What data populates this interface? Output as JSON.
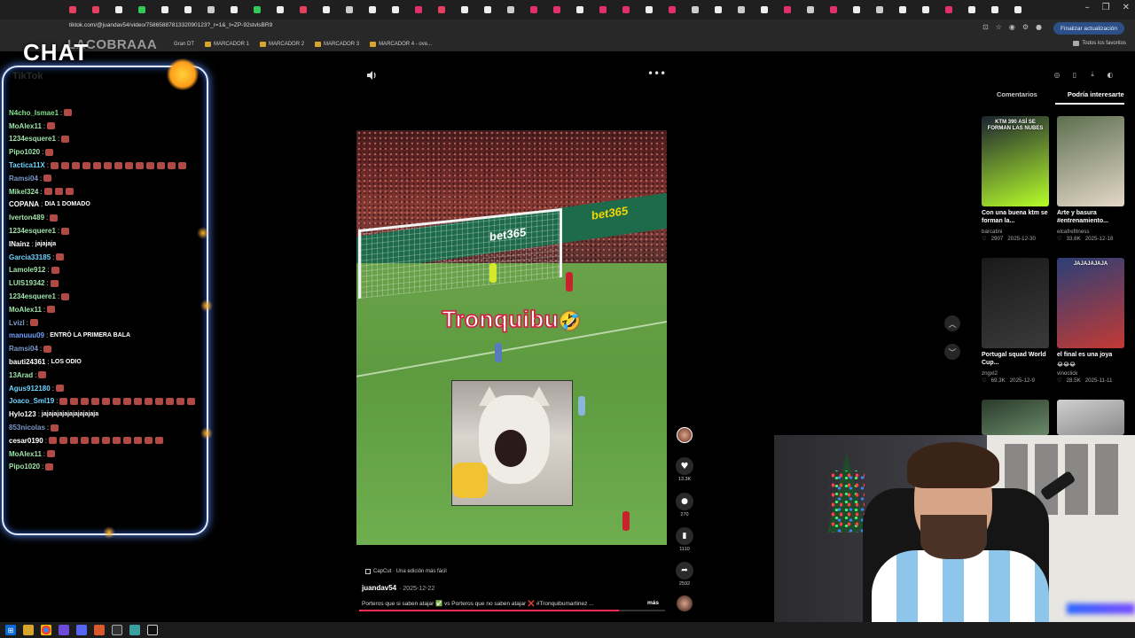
{
  "browser": {
    "url": "tiktok.com/@juandav54/video/7586588781332090123?_r=1&_t=ZP-92stvlsBR9",
    "update_button": "Finalizar actualización",
    "bookmarks": [
      "Gran DT",
      "MARCADOR 1",
      "MARCADOR 2",
      "MARCADOR 3",
      "MARCADOR 4 - ove..."
    ],
    "bookmarks_right": "Todos los favoritos",
    "window_controls": [
      "–",
      "❐",
      "✕"
    ]
  },
  "overlay": {
    "chat_title": "CHAT",
    "brand": "LACOBRAAA",
    "faint_label": "TikTok",
    "accent": "#dfe9ff",
    "glow": "#5a8cff"
  },
  "chat": [
    {
      "user": "N4cho_Ismae1",
      "color": "#7fe38a",
      "text": "",
      "emotes": 1
    },
    {
      "user": "MoAlex11",
      "color": "#9fe3a8",
      "text": "",
      "emotes": 1
    },
    {
      "user": "1234esquere1",
      "color": "#9fe3a8",
      "text": "",
      "emotes": 1
    },
    {
      "user": "Pipo1020",
      "color": "#9fe3a8",
      "text": "",
      "emotes": 1
    },
    {
      "user": "Tactica11X",
      "color": "#6fd4ff",
      "text": "",
      "emotes": 13
    },
    {
      "user": "Ramsi04",
      "color": "#7a9acb",
      "text": "",
      "emotes": 1
    },
    {
      "user": "Mikel324",
      "color": "#9fe3a8",
      "text": "",
      "emotes": 3
    },
    {
      "user": "COPANA",
      "color": "#ffffff",
      "text": "DIA 1 DOMADO",
      "emotes": 0
    },
    {
      "user": "Iverton489",
      "color": "#9fe3a8",
      "text": "",
      "emotes": 1
    },
    {
      "user": "1234esquere1",
      "color": "#9fe3a8",
      "text": "",
      "emotes": 1
    },
    {
      "user": "INainz",
      "color": "#ffffff",
      "text": "jajajaja",
      "emotes": 0
    },
    {
      "user": "Garcia33185",
      "color": "#6fd4ff",
      "text": "",
      "emotes": 1
    },
    {
      "user": "Lamole912",
      "color": "#9fe3a8",
      "text": "",
      "emotes": 1
    },
    {
      "user": "LUIS19342",
      "color": "#9fe3a8",
      "text": "",
      "emotes": 1
    },
    {
      "user": "1234esquere1",
      "color": "#9fe3a8",
      "text": "",
      "emotes": 1
    },
    {
      "user": "MoAlex11",
      "color": "#9fe3a8",
      "text": "",
      "emotes": 1
    },
    {
      "user": "Lvizl",
      "color": "#7a9acb",
      "text": "",
      "emotes": 1
    },
    {
      "user": "manuuu09",
      "color": "#6fa0ff",
      "text": "ENTRÓ LA PRIMERA BALA",
      "emotes": 0
    },
    {
      "user": "Ramsi04",
      "color": "#7a9acb",
      "text": "",
      "emotes": 1
    },
    {
      "user": "bauti24361",
      "color": "#ffffff",
      "text": "LOS ODIO",
      "emotes": 0
    },
    {
      "user": "13Arad",
      "color": "#9fe3a8",
      "text": "",
      "emotes": 1
    },
    {
      "user": "Agus912180",
      "color": "#6fd4ff",
      "text": "",
      "emotes": 1
    },
    {
      "user": "Joaco_Sml19",
      "color": "#6fd4ff",
      "text": "",
      "emotes": 13
    },
    {
      "user": "Hylo123",
      "color": "#ffffff",
      "text": "jajajajajajajajajajaja",
      "emotes": 0
    },
    {
      "user": "853nicolas",
      "color": "#7a9acb",
      "text": "",
      "emotes": 1
    },
    {
      "user": "cesar0190",
      "color": "#ffffff",
      "text": "",
      "emotes": 11
    },
    {
      "user": "MoAlex11",
      "color": "#9fe3a8",
      "text": "",
      "emotes": 1
    },
    {
      "user": "Pipo1020",
      "color": "#9fe3a8",
      "text": "",
      "emotes": 1
    }
  ],
  "video": {
    "caption": "Tronquibu",
    "caption_emoji": "🤣",
    "ad_text": "bet365",
    "capcut_label": "CapCut · Una edición más fácil",
    "author": "juandav54",
    "date": "· 2025-12-22",
    "description": "Porteros que si saben atajar ✅ vs Porteros que no saben atajar ❌ #Tronquibumartinez ...",
    "more": "más",
    "progress_fraction": 0.85,
    "likes": "13.3K",
    "comments": "270",
    "saves": "1110",
    "shares": "2592"
  },
  "right_panel": {
    "tabs": [
      "Comentarios",
      "Podría interesarte"
    ],
    "active_tab": 1,
    "cards": [
      {
        "title": "Con una buena ktm se forman la...",
        "author": "barcatini",
        "likes": "2907",
        "date": "2025-12-30",
        "thumb_colors": [
          "#1b2330",
          "#b7ff2a"
        ],
        "overlay": "KTM 390 ASÍ SE FORMAN LAS NUBES"
      },
      {
        "title": "Arte y basura #entrenamiento...",
        "author": "elcafrefitness",
        "likes": "33.6K",
        "date": "2025-12-18",
        "thumb_colors": [
          "#5d6f4f",
          "#e4d8c8"
        ],
        "overlay": ""
      },
      {
        "title": "Portugal squad World Cup...",
        "author": "zngxl2",
        "likes": "69.3K",
        "date": "2025-12-9",
        "thumb_colors": [
          "#1a1a1a",
          "#3a3a3a"
        ],
        "overlay": ""
      },
      {
        "title": "el final es una joya",
        "author": "vinoclick",
        "likes": "28.5K",
        "date": "2025-11-11",
        "thumb_colors": [
          "#2b3f78",
          "#c33a34"
        ],
        "overlay": "JAJAJAJAJA"
      },
      {
        "title": "",
        "author": "",
        "likes": "",
        "date": "",
        "thumb_colors": [
          "#2a3a2a",
          "#6a8a6a"
        ],
        "overlay": ""
      },
      {
        "title": "",
        "author": "",
        "likes": "",
        "date": "",
        "thumb_colors": [
          "#cfcfcf",
          "#8a8a8a"
        ],
        "overlay": ""
      }
    ],
    "title_icons": [
      "◎",
      "▯",
      "⤓",
      "◐"
    ],
    "card_emoji": "😂😂😂"
  },
  "taskbar": {
    "icons": [
      "windows-icon",
      "file-explorer-icon",
      "chrome-icon",
      "app-icon",
      "discord-icon",
      "obs-icon",
      "chrome-alt-icon",
      "maps-icon",
      "terminal-icon"
    ]
  }
}
